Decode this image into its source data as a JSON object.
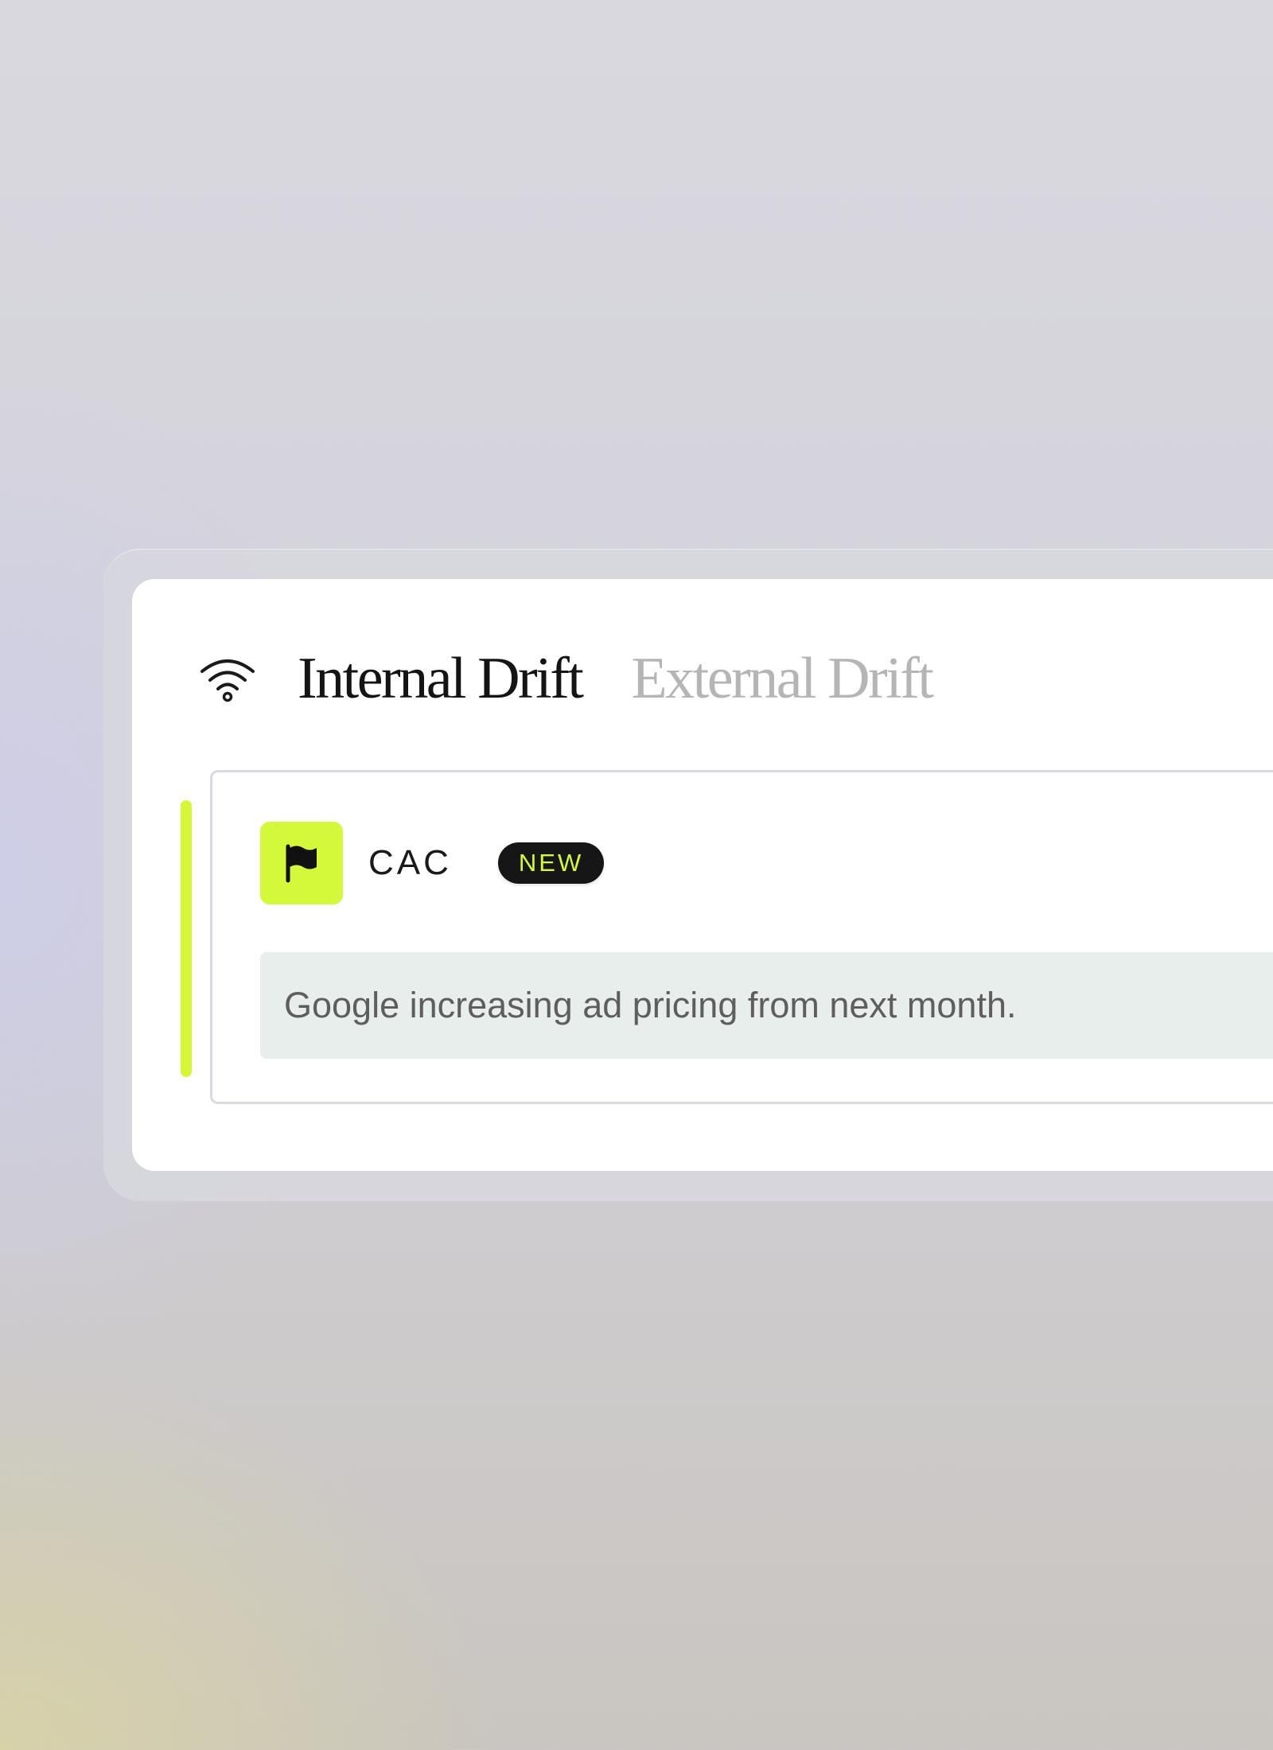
{
  "tabs": {
    "internal_label": "Internal Drift",
    "external_label": "External Drift",
    "active": "Internal Drift"
  },
  "drift_item": {
    "metric": "CAC",
    "badge": "NEW",
    "icon": "flag-icon",
    "message": "Google increasing ad pricing from next month."
  },
  "icons": {
    "tab_bar": "wifi-icon",
    "drift_item": "flag-icon"
  },
  "colors": {
    "accent": "#d4f93b",
    "badge_background": "#161616",
    "message_background": "#e8eeec",
    "inactive_tab": "#b5b5b5"
  }
}
